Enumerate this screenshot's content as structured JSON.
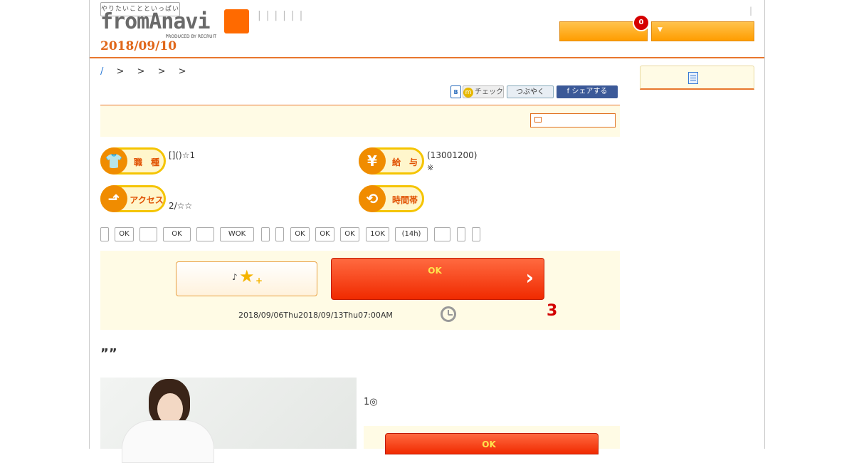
{
  "header": {
    "tagline": "やりたいことといっぱい",
    "logo_text": "fromAnavi",
    "logo_sub": "PRODUCED BY RECRUIT",
    "nav_bars": "||||||",
    "small_bar": "|",
    "date": "2018/09/10",
    "badge_count": "0",
    "dropdown_arrow": "▼"
  },
  "breadcrumb": {
    "slash": "/",
    "separators": "> > > >"
  },
  "social": {
    "hatena": "B",
    "mixi_label": "チェック",
    "mixi_mark": "m",
    "twitter_label": "つぶやく",
    "facebook_label": "f シェアする"
  },
  "job": {
    "type_label": "職　種",
    "type_icon": "👕",
    "type_value": "[]()☆1",
    "salary_label": "給　与",
    "salary_icon": "¥",
    "salary_value": "(13001200)",
    "salary_note": "※",
    "access_label": "アクセス",
    "access_icon": "⬏",
    "access_value": "2/☆☆",
    "time_label": "時間帯",
    "time_icon": "⟲"
  },
  "tags": [
    "",
    "OK",
    "",
    "OK",
    "",
    "WOK",
    "",
    "",
    "OK",
    "OK",
    "OK",
    "1OK",
    "(14h)",
    "",
    "",
    ""
  ],
  "apply": {
    "keep_note": "♪",
    "keep_star": "★",
    "keep_plus": "+",
    "go_label": "OK",
    "go_chevron": "›",
    "period": "2018/09/06Thu2018/09/13Thu07:00AM",
    "remaining": "3"
  },
  "article": {
    "quote": "””",
    "description": "1◎",
    "go_label": "OK"
  }
}
